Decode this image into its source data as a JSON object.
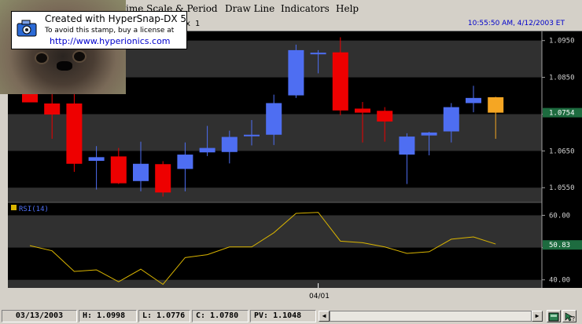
{
  "menu": {
    "items": [
      {
        "label": "Time Scale & Period",
        "x": 152
      },
      {
        "label": "Draw Line",
        "x": 286
      },
      {
        "label": "Indicators",
        "x": 357
      },
      {
        "label": "Help",
        "x": 427
      }
    ]
  },
  "tab": {
    "text": "x 1"
  },
  "timestamp": "10:55:50 AM, 4/12/2003 ET",
  "stamp": {
    "title": "Created with HyperSnap-DX 5",
    "line2": "To avoid this stamp, buy a license at",
    "url": "http://www.hyperionics.com"
  },
  "colors": {
    "up": "#4e6ef2",
    "down": "#ee0000",
    "last": "#f5a623",
    "rsi": "#d9b400",
    "band_dark": "#000000",
    "band_light": "#303030",
    "badge": "#1d6b3f"
  },
  "chart_data": [
    {
      "type": "candlestick",
      "ylim": [
        1.051,
        1.0975
      ],
      "yticks": [
        1.095,
        1.085,
        1.075,
        1.065,
        1.055
      ],
      "ytick_labels": [
        "1.0950",
        "1.0850",
        "",
        "1.0650",
        "1.0550"
      ],
      "last_value_label": "1.0754",
      "last_value": 1.0754,
      "candles": [
        {
          "o": 1.0888,
          "h": 1.0898,
          "l": 1.0782,
          "c": 1.0782
        },
        {
          "o": 1.0779,
          "h": 1.0825,
          "l": 1.0683,
          "c": 1.0749
        },
        {
          "o": 1.0779,
          "h": 1.0845,
          "l": 1.0593,
          "c": 1.0615
        },
        {
          "o": 1.0623,
          "h": 1.0663,
          "l": 1.0545,
          "c": 1.0633
        },
        {
          "o": 1.0635,
          "h": 1.0658,
          "l": 1.056,
          "c": 1.0562
        },
        {
          "o": 1.0568,
          "h": 1.0675,
          "l": 1.054,
          "c": 1.0615
        },
        {
          "o": 1.0614,
          "h": 1.0622,
          "l": 1.0526,
          "c": 1.0537
        },
        {
          "o": 1.0601,
          "h": 1.0673,
          "l": 1.054,
          "c": 1.064
        },
        {
          "o": 1.0646,
          "h": 1.0718,
          "l": 1.0636,
          "c": 1.0658
        },
        {
          "o": 1.0647,
          "h": 1.0705,
          "l": 1.0616,
          "c": 1.0688
        },
        {
          "o": 1.0694,
          "h": 1.0734,
          "l": 1.0665,
          "c": 1.0694
        },
        {
          "o": 1.0694,
          "h": 1.0803,
          "l": 1.0666,
          "c": 1.078
        },
        {
          "o": 1.0801,
          "h": 1.0939,
          "l": 1.0794,
          "c": 1.0924
        },
        {
          "o": 1.0917,
          "h": 1.0924,
          "l": 1.0861,
          "c": 1.0917
        },
        {
          "o": 1.0918,
          "h": 1.0959,
          "l": 1.0747,
          "c": 1.076
        },
        {
          "o": 1.0765,
          "h": 1.0783,
          "l": 1.0673,
          "c": 1.0754
        },
        {
          "o": 1.0759,
          "h": 1.0769,
          "l": 1.0675,
          "c": 1.073
        },
        {
          "o": 1.064,
          "h": 1.0698,
          "l": 1.056,
          "c": 1.0689
        },
        {
          "o": 1.0692,
          "h": 1.0702,
          "l": 1.0638,
          "c": 1.07
        },
        {
          "o": 1.0703,
          "h": 1.078,
          "l": 1.0673,
          "c": 1.0769
        },
        {
          "o": 1.078,
          "h": 1.0827,
          "l": 1.0755,
          "c": 1.0794
        },
        {
          "o": 1.0796,
          "h": 1.0797,
          "l": 1.0683,
          "c": 1.0754
        }
      ]
    },
    {
      "type": "line",
      "legend": "RSI(14)",
      "ylim": [
        37.5,
        64
      ],
      "yticks": [
        60.0,
        50.0,
        40.0
      ],
      "ytick_labels": [
        "60.00",
        "",
        "40.00"
      ],
      "last_value_label": "50.83",
      "last_value": 50.83,
      "values": [
        50.6,
        49.0,
        42.6,
        43.1,
        39.4,
        43.3,
        38.6,
        46.9,
        47.8,
        50.2,
        50.2,
        54.6,
        60.6,
        60.9,
        52.0,
        51.5,
        50.2,
        48.2,
        48.7,
        52.6,
        53.3,
        51.1
      ],
      "x_tick_label": "04/01",
      "x_tick_index": 13
    }
  ],
  "status": {
    "date": "03/13/2003",
    "high": "H: 1.0998",
    "low": "L: 1.0776",
    "close": "C: 1.0780",
    "pv": "PV: 1.1048"
  }
}
